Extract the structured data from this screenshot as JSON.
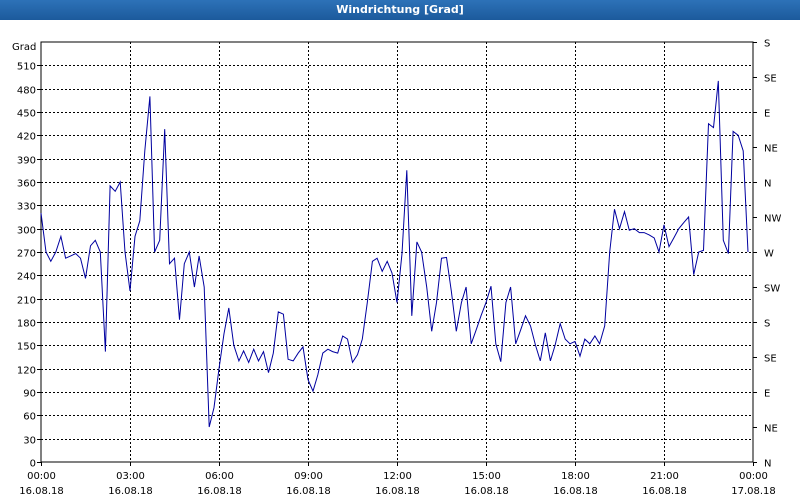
{
  "window": {
    "title": "Windrichtung [Grad]"
  },
  "chart_data": {
    "type": "line",
    "title": "Windrichtung [Grad]",
    "ylabel": "Grad",
    "ylim": [
      0,
      540
    ],
    "yticks": [
      0,
      30,
      60,
      90,
      120,
      150,
      180,
      210,
      240,
      270,
      300,
      330,
      360,
      390,
      420,
      450,
      480,
      510
    ],
    "xlim": [
      0,
      24
    ],
    "xticks": [
      {
        "hour": 0,
        "time": "00:00",
        "date": "16.08.18"
      },
      {
        "hour": 3,
        "time": "03:00",
        "date": "16.08.18"
      },
      {
        "hour": 6,
        "time": "06:00",
        "date": "16.08.18"
      },
      {
        "hour": 9,
        "time": "09:00",
        "date": "16.08.18"
      },
      {
        "hour": 12,
        "time": "12:00",
        "date": "16.08.18"
      },
      {
        "hour": 15,
        "time": "15:00",
        "date": "16.08.18"
      },
      {
        "hour": 18,
        "time": "18:00",
        "date": "16.08.18"
      },
      {
        "hour": 21,
        "time": "21:00",
        "date": "16.08.18"
      },
      {
        "hour": 24,
        "time": "00:00",
        "date": "17.08.18"
      }
    ],
    "right_axis": [
      {
        "value": 0,
        "label": "N"
      },
      {
        "value": 45,
        "label": "NE"
      },
      {
        "value": 90,
        "label": "E"
      },
      {
        "value": 135,
        "label": "SE"
      },
      {
        "value": 180,
        "label": "S"
      },
      {
        "value": 225,
        "label": "SW"
      },
      {
        "value": 270,
        "label": "W"
      },
      {
        "value": 315,
        "label": "NW"
      },
      {
        "value": 360,
        "label": "N"
      },
      {
        "value": 405,
        "label": "NE"
      },
      {
        "value": 450,
        "label": "E"
      },
      {
        "value": 495,
        "label": "SE"
      },
      {
        "value": 540,
        "label": "S"
      }
    ],
    "grid": true,
    "line_color": "#0000a0",
    "series": [
      {
        "x": [
          0.0,
          0.17,
          0.33,
          0.5,
          0.67,
          0.83,
          1.0,
          1.17,
          1.33,
          1.5,
          1.67,
          1.83,
          2.0,
          2.17,
          2.33,
          2.5,
          2.67,
          2.83,
          3.0,
          3.17,
          3.33,
          3.5,
          3.67,
          3.83,
          4.0,
          4.17,
          4.33,
          4.5,
          4.67,
          4.83,
          5.0,
          5.17,
          5.33,
          5.5,
          5.67,
          5.83,
          6.0,
          6.17,
          6.33,
          6.5,
          6.67,
          6.83,
          7.0,
          7.17,
          7.33,
          7.5,
          7.67,
          7.83,
          8.0,
          8.17,
          8.33,
          8.5,
          8.67,
          8.83,
          9.0,
          9.17,
          9.33,
          9.5,
          9.67,
          9.83,
          10.0,
          10.17,
          10.33,
          10.5,
          10.67,
          10.83,
          11.0,
          11.17,
          11.33,
          11.5,
          11.67,
          11.83,
          12.0,
          12.17,
          12.33,
          12.5,
          12.67,
          12.83,
          13.0,
          13.17,
          13.33,
          13.5,
          13.67,
          13.83,
          14.0,
          14.17,
          14.33,
          14.5,
          14.67,
          14.83,
          15.0,
          15.17,
          15.33,
          15.5,
          15.67,
          15.83,
          16.0,
          16.17,
          16.33,
          16.5,
          16.67,
          16.83,
          17.0,
          17.17,
          17.33,
          17.5,
          17.67,
          17.83,
          18.0,
          18.17,
          18.33,
          18.5,
          18.67,
          18.83,
          19.0,
          19.17,
          19.33,
          19.5,
          19.67,
          19.83,
          20.0,
          20.17,
          20.33,
          20.5,
          20.67,
          20.83,
          21.0,
          21.17,
          21.33,
          21.5,
          21.67,
          21.83,
          22.0,
          22.17,
          22.33,
          22.5,
          22.67,
          22.83,
          23.0,
          23.17,
          23.33,
          23.5,
          23.67,
          23.83
        ],
        "y": [
          320,
          270,
          258,
          270,
          290,
          262,
          265,
          268,
          262,
          236,
          278,
          285,
          270,
          142,
          355,
          348,
          360,
          270,
          220,
          290,
          310,
          400,
          470,
          270,
          285,
          428,
          255,
          262,
          183,
          255,
          270,
          225,
          265,
          225,
          45,
          70,
          120,
          165,
          198,
          150,
          130,
          143,
          128,
          145,
          130,
          142,
          115,
          140,
          193,
          190,
          132,
          130,
          140,
          148,
          106,
          91,
          112,
          140,
          145,
          142,
          140,
          162,
          158,
          128,
          138,
          158,
          205,
          258,
          262,
          245,
          258,
          243,
          205,
          268,
          375,
          188,
          283,
          270,
          225,
          168,
          205,
          262,
          263,
          220,
          168,
          205,
          225,
          152,
          170,
          188,
          205,
          226,
          152,
          129,
          205,
          225,
          152,
          170,
          188,
          175,
          150,
          130,
          166,
          130,
          150,
          178,
          158,
          152,
          155,
          136,
          158,
          152,
          162,
          152,
          175,
          270,
          325,
          300,
          322,
          298,
          300,
          295,
          295,
          292,
          288,
          270,
          305,
          277,
          288,
          300,
          308,
          315,
          241,
          270,
          272,
          435,
          430,
          490,
          285,
          268,
          425,
          420,
          400,
          270
        ]
      }
    ]
  }
}
